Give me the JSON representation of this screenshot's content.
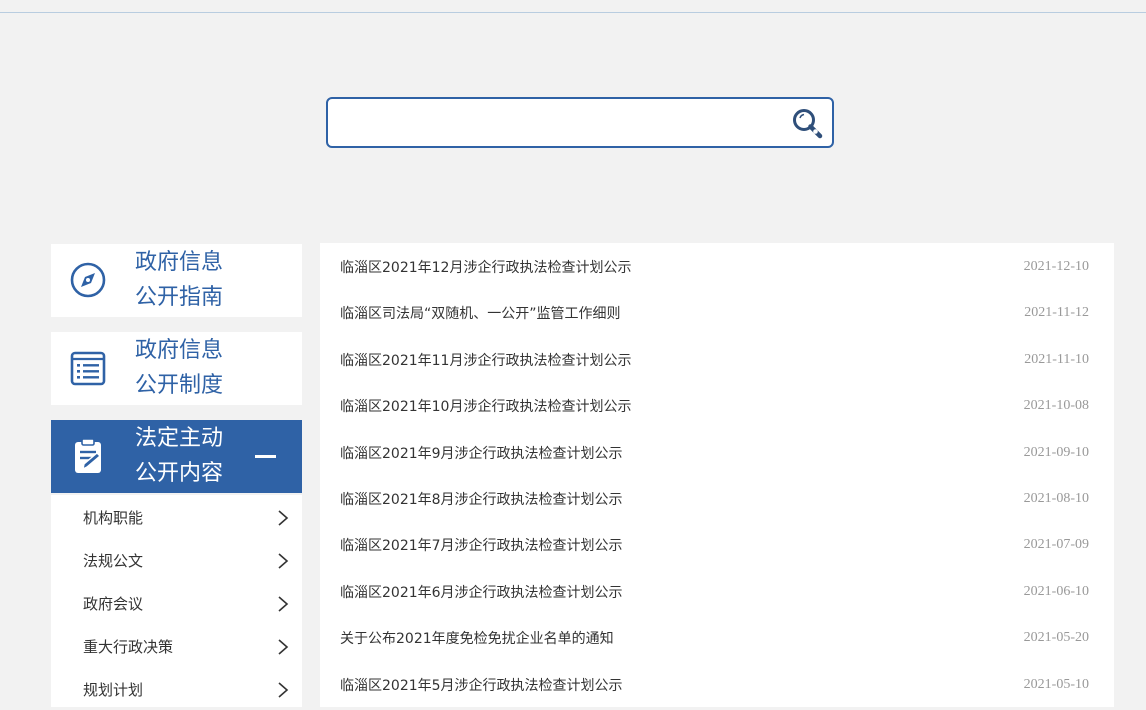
{
  "search": {
    "value": "",
    "placeholder": "",
    "button_icon": "search-magnifier-icon"
  },
  "sidebar": {
    "sections": [
      {
        "line1": "政府信息",
        "line2": "公开指南",
        "icon": "compass-icon",
        "active": false
      },
      {
        "line1": "政府信息",
        "line2": "公开制度",
        "icon": "document-list-icon",
        "active": false
      },
      {
        "line1": "法定主动",
        "line2": "公开内容",
        "icon": "clipboard-edit-icon",
        "active": true
      }
    ],
    "sub_items": [
      {
        "label": "机构职能"
      },
      {
        "label": "法规公文"
      },
      {
        "label": "政府会议"
      },
      {
        "label": "重大行政决策"
      },
      {
        "label": "规划计划"
      }
    ]
  },
  "list": [
    {
      "title": "临淄区2021年12月涉企行政执法检查计划公示",
      "date": "2021-12-10"
    },
    {
      "title": "临淄区司法局“双随机、一公开”监管工作细则",
      "date": "2021-11-12"
    },
    {
      "title": "临淄区2021年11月涉企行政执法检查计划公示",
      "date": "2021-11-10"
    },
    {
      "title": "临淄区2021年10月涉企行政执法检查计划公示",
      "date": "2021-10-08"
    },
    {
      "title": "临淄区2021年9月涉企行政执法检查计划公示",
      "date": "2021-09-10"
    },
    {
      "title": "临淄区2021年8月涉企行政执法检查计划公示",
      "date": "2021-08-10"
    },
    {
      "title": "临淄区2021年7月涉企行政执法检查计划公示",
      "date": "2021-07-09"
    },
    {
      "title": "临淄区2021年6月涉企行政执法检查计划公示",
      "date": "2021-06-10"
    },
    {
      "title": "关于公布2021年度免检免扰企业名单的通知",
      "date": "2021-05-20"
    },
    {
      "title": "临淄区2021年5月涉企行政执法检查计划公示",
      "date": "2021-05-10"
    }
  ],
  "colors": {
    "brand": "#2f62a6",
    "background": "#f2f2f2",
    "date_text": "#999999"
  }
}
